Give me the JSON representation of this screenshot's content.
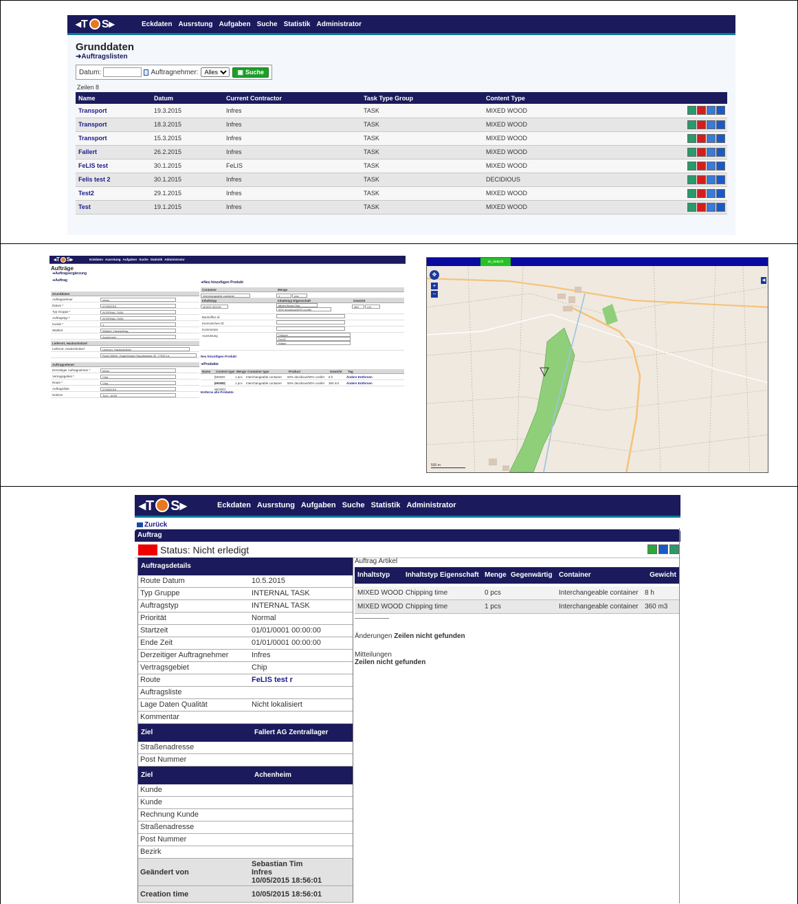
{
  "nav": {
    "logo": "TCS",
    "items": [
      "Eckdaten",
      "Ausrstung",
      "Aufgaben",
      "Suche",
      "Statistik",
      "Administrator"
    ]
  },
  "panel1": {
    "title": "Grunddaten",
    "subtitle": "➜Auftragslisten",
    "filter": {
      "datum_label": "Datum:",
      "datum_value": "",
      "auftragnehmer_label": "Auftragnehmer:",
      "auftragnehmer_value": "Alles",
      "search_button": "Suche"
    },
    "row_count": "Zeilen 8",
    "columns": [
      "Name",
      "Datum",
      "Current Contractor",
      "Task Type Group",
      "Content Type"
    ],
    "rows": [
      {
        "name": "Transport",
        "datum": "19.3.2015",
        "contractor": "Infres",
        "group": "TASK",
        "content": "MIXED WOOD"
      },
      {
        "name": "Transport",
        "datum": "18.3.2015",
        "contractor": "Infres",
        "group": "TASK",
        "content": "MIXED WOOD"
      },
      {
        "name": "Transport",
        "datum": "15.3.2015",
        "contractor": "Infres",
        "group": "TASK",
        "content": "MIXED WOOD"
      },
      {
        "name": "Fallert",
        "datum": "26.2.2015",
        "contractor": "Infres",
        "group": "TASK",
        "content": "MIXED WOOD"
      },
      {
        "name": "FeLIS test",
        "datum": "30.1.2015",
        "contractor": "FeLIS",
        "group": "TASK",
        "content": "MIXED WOOD"
      },
      {
        "name": "Felis test 2",
        "datum": "30.1.2015",
        "contractor": "Infres",
        "group": "TASK",
        "content": "DECIDIOUS"
      },
      {
        "name": "Test2",
        "datum": "29.1.2015",
        "contractor": "Infres",
        "group": "TASK",
        "content": "MIXED WOOD"
      },
      {
        "name": "Test",
        "datum": "19.1.2015",
        "contractor": "Infres",
        "group": "TASK",
        "content": "MIXED WOOD"
      }
    ]
  },
  "panel2": {
    "title": "Aufträge",
    "subtitle": "➜Auftragsergänzung",
    "auftrag": "➜Auftrag",
    "grunddaten": "Grunddaten",
    "form": [
      {
        "k": "Auftragnehmer",
        "v": "Infres"
      },
      {
        "k": "Datum *",
        "v": "07/05/2015"
      },
      {
        "k": "Typ Gruppe *",
        "v": "INTERNAL TASK"
      },
      {
        "k": "Auftragstyp *",
        "v": "INTERNAL TASK"
      },
      {
        "k": "Kunde *",
        "v": "1"
      },
      {
        "k": "Waldort",
        "v": "Waldort, Hackauftrag"
      },
      {
        "k": "",
        "v": "Achenheim"
      }
    ],
    "lieferort_header": "Lieferort, Hackschnitzel",
    "lieferort_value": "Lieferort, Hackschnitzel",
    "lieferort_addr": "Rudol Mühle, Hugenberger Hauptstrasse 32, 77933 La",
    "auftragnehmer_header": "Auftragnehmer",
    "form2": [
      {
        "k": "Derzeitiger Auftragnehmer *",
        "v": "Infres"
      },
      {
        "k": "Vertragsgebiet *",
        "v": "Chip"
      },
      {
        "k": "Route *",
        "v": "Chip"
      },
      {
        "k": "Auftragsliste",
        "v": "07/05/2015"
      },
      {
        "k": "Notizen",
        "v": "Tuhl - 18:00"
      }
    ],
    "kunde_hinzufuegen": "Kunden hinzufügen",
    "kunde_value": "Gemeinde Malsch, Hauptstrasse 49, Malsc",
    "zeit_hinzufuegen": "Zeit hinzufügen",
    "suche": "Suche",
    "waehle": "Wähle",
    "produkt_title": "➜Neu hinzufügen Produkt",
    "produkt_cols": [
      "Container",
      "Menge",
      "Inhaltstyp",
      "Inhaltstyp Eigenschaft",
      "Gewicht"
    ],
    "container_value": "Interchangeable container",
    "menge_value": "1",
    "menge_unit": "pcs",
    "inhaltstyp_value": "MIXED WOOD",
    "eigenschaft_value": "Mixed Wood Chip",
    "eigenschaft_value2": "50% decidious/50% conifer",
    "gewicht_value": "360",
    "gewicht_unit": "m3",
    "fields": [
      "Backoffice id",
      "Kennzeichen ID",
      "Kommentar",
      "Ausrüstung"
    ],
    "ausruestung_opts": [
      "Chipper",
      "FeLIS",
      "Wähle"
    ],
    "neu_produkt_link": "Neu hinzufügen Produkt",
    "produkte_title": "➜Produkte",
    "produkte_cols": [
      "Name",
      "Content type",
      "Menge",
      "Container type",
      "Product",
      "Gewicht",
      "Tag"
    ],
    "produkte_rows": [
      {
        "content": "[MIXED WOOD]",
        "menge": "1 pcs",
        "container": "Interchangeable container",
        "product": "50% decidious/50% conifer",
        "gewicht": "8 h",
        "actions": "Ändere Entfernen"
      },
      {
        "content": "[MIXED WOOD]",
        "menge": "1 pcs",
        "container": "Interchangeable container",
        "product": "50% decidious/50% conifer",
        "gewicht": "360 m3",
        "actions": "Ändere Entfernen"
      }
    ],
    "entferne": "Entferne alle Produkte"
  },
  "map": {
    "tab_label": "ss_search",
    "scale_label": "500 m"
  },
  "panel3": {
    "back": "Zurück",
    "header": "Auftrag",
    "status": "Status: Nicht erledigt",
    "details_header": "Auftragsdetails",
    "details": [
      {
        "k": "Route Datum",
        "v": "10.5.2015"
      },
      {
        "k": "Typ Gruppe",
        "v": "INTERNAL TASK"
      },
      {
        "k": "Auftragstyp",
        "v": "INTERNAL TASK"
      },
      {
        "k": "Priorität",
        "v": "Normal"
      },
      {
        "k": "Startzeit",
        "v": "01/01/0001 00:00:00"
      },
      {
        "k": "Ende Zeit",
        "v": "01/01/0001 00:00:00"
      },
      {
        "k": "Derzeitiger Auftragnehmer",
        "v": "Infres"
      },
      {
        "k": "Vertragsgebiet",
        "v": "Chip"
      },
      {
        "k": "Route",
        "v": "FeLIS test r"
      },
      {
        "k": "Auftragsliste",
        "v": ""
      },
      {
        "k": "Lage Daten Qualität",
        "v": "Nicht lokalisiert"
      },
      {
        "k": "Kommentar",
        "v": ""
      }
    ],
    "ziel1_label": "Ziel",
    "ziel1_value": "Fallert AG Zentrallager",
    "ziel1_rows": [
      "Straßenadresse",
      "Post Nummer"
    ],
    "ziel2_label": "Ziel",
    "ziel2_value": "Achenheim",
    "ziel2_rows": [
      "Kunde",
      "Kunde",
      "Rechnung Kunde",
      "Straßenadresse",
      "Post Nummer",
      "Bezirk"
    ],
    "geaendert_label": "Geändert von",
    "geaendert_value": [
      "Sebastian Tim",
      "Infres",
      "10/05/2015 18:56:01"
    ],
    "creation_label": "Creation time",
    "creation_value": "10/05/2015 18:56:01",
    "artikel_title": "Auftrag Artikel",
    "artikel_cols": [
      "Inhaltstyp",
      "Inhaltstyp Eigenschaft",
      "Menge",
      "Gegenwärtig",
      "Container",
      "Gewicht"
    ],
    "artikel_rows": [
      {
        "inhaltstyp": "MIXED WOOD",
        "eigenschaft": "Chipping time",
        "menge": "0 pcs",
        "container": "Interchangeable container",
        "gewicht": "8 h"
      },
      {
        "inhaltstyp": "MIXED WOOD",
        "eigenschaft": "Chipping time",
        "menge": "1 pcs",
        "container": "Interchangeable container",
        "gewicht": "360 m3"
      }
    ],
    "aenderungen_label": "Änderungen",
    "aenderungen_value": "Zeilen nicht gefunden",
    "mitteilungen_label": "Mitteilungen",
    "mitteilungen_value": "Zeilen nicht gefunden"
  }
}
